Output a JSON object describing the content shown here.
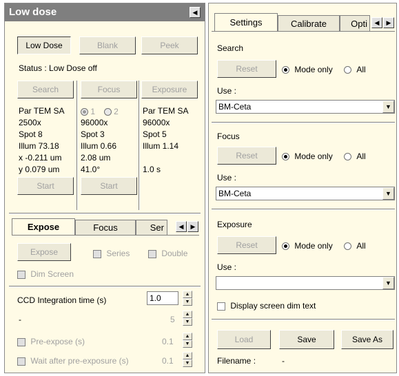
{
  "left": {
    "title": "Low dose",
    "buttons": {
      "low_dose": "Low Dose",
      "blank": "Blank",
      "peek": "Peek"
    },
    "status": "Status : Low Dose off",
    "columns": {
      "search": {
        "button": "Search",
        "lines": [
          "Par TEM SA",
          "2500x",
          "Spot  8",
          "Illum  73.18",
          "x  -0.211 um",
          "y  0.079 um"
        ],
        "start": "Start"
      },
      "focus": {
        "button": "Focus",
        "radio1": "1",
        "radio2": "2",
        "lines": [
          "96000x",
          "Spot  3",
          "Illum  0.66",
          "2.08 um",
          "41.0°"
        ],
        "start": "Start"
      },
      "exposure": {
        "button": "Exposure",
        "lines": [
          "Par TEM SA",
          "96000x",
          "Spot  5",
          "Illum  1.14",
          "",
          "1.0 s"
        ]
      }
    },
    "tabs": [
      "Expose",
      "Focus",
      "Ser"
    ],
    "expose": {
      "expose_btn": "Expose",
      "series": "Series",
      "double": "Double",
      "dim_screen": "Dim Screen",
      "ccd_label": "CCD Integration time (s)",
      "ccd_value": "1.0",
      "dash": "-",
      "count": "5",
      "pre_expose": "Pre-expose (s)",
      "pre_expose_val": "0.1",
      "wait_after": "Wait after pre-exposure (s)",
      "wait_after_val": "0.1"
    }
  },
  "right": {
    "tabs": [
      "Settings",
      "Calibrate",
      "Opti"
    ],
    "search": {
      "heading": "Search",
      "reset": "Reset",
      "mode_only": "Mode only",
      "all": "All",
      "use": "Use :",
      "use_value": "BM-Ceta"
    },
    "focus": {
      "heading": "Focus",
      "reset": "Reset",
      "mode_only": "Mode only",
      "all": "All",
      "use": "Use :",
      "use_value": "BM-Ceta"
    },
    "exposure": {
      "heading": "Exposure",
      "reset": "Reset",
      "mode_only": "Mode only",
      "all": "All",
      "use": "Use :",
      "use_value": ""
    },
    "display_dim": "Display screen dim text",
    "load": "Load",
    "save": "Save",
    "save_as": "Save As",
    "filename_label": "Filename :",
    "filename_value": "-"
  }
}
